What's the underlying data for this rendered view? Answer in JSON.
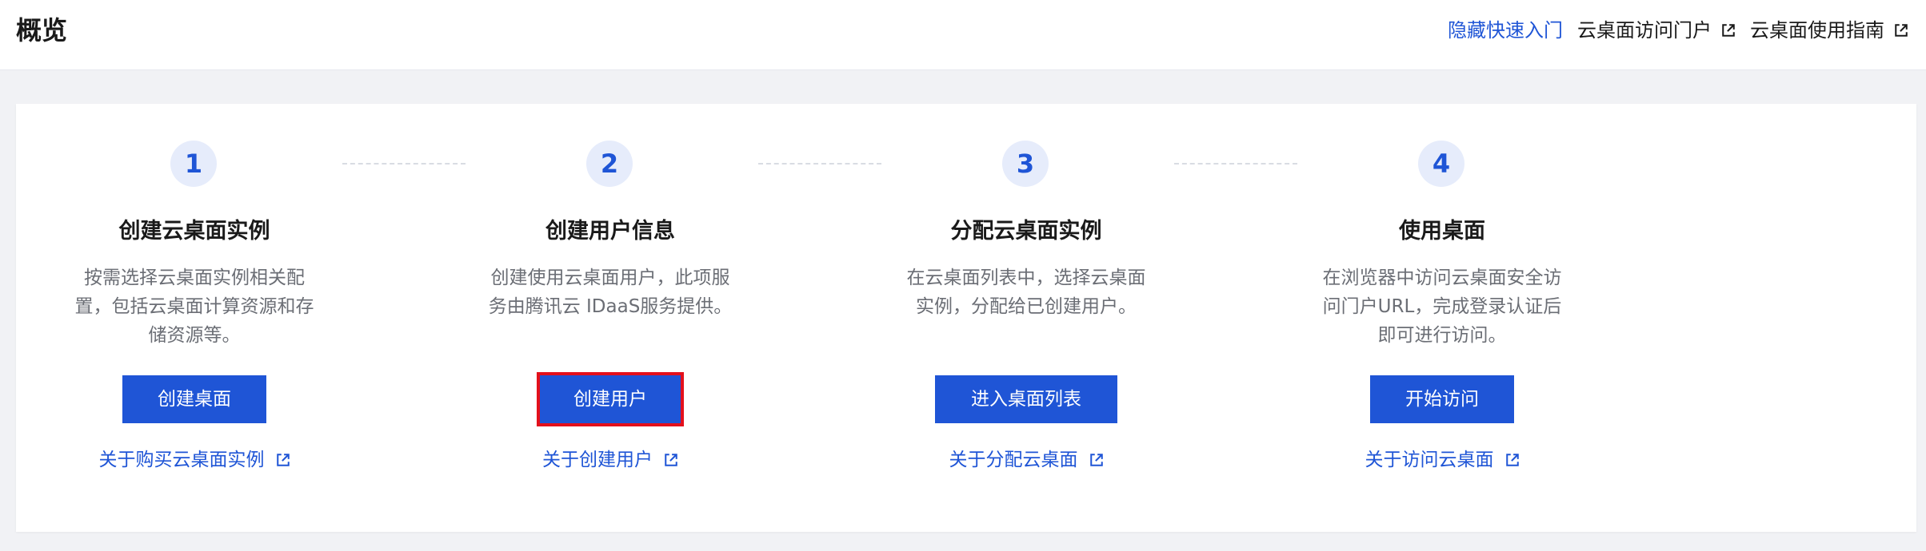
{
  "header": {
    "title": "概览",
    "links": [
      {
        "label": "隐藏快速入门",
        "external": false
      },
      {
        "label": "云桌面访问门户",
        "external": true
      },
      {
        "label": "云桌面使用指南",
        "external": true
      }
    ]
  },
  "steps": [
    {
      "number": "1",
      "title": "创建云桌面实例",
      "desc": "按需选择云桌面实例相关配置，包括云桌面计算资源和存储资源等。",
      "button": "创建桌面",
      "link": "关于购买云桌面实例"
    },
    {
      "number": "2",
      "title": "创建用户信息",
      "desc": "创建使用云桌面用户，此项服务由腾讯云 IDaaS服务提供。",
      "button": "创建用户",
      "link": "关于创建用户"
    },
    {
      "number": "3",
      "title": "分配云桌面实例",
      "desc": "在云桌面列表中，选择云桌面实例，分配给已创建用户。",
      "button": "进入桌面列表",
      "link": "关于分配云桌面"
    },
    {
      "number": "4",
      "title": "使用桌面",
      "desc": "在浏览器中访问云桌面安全访问门户URL，完成登录认证后即可进行访问。",
      "button": "开始访问",
      "link": "关于访问云桌面"
    }
  ],
  "colors": {
    "accent": "#1f55d6",
    "highlight": "#e3101c",
    "step_badge_bg": "#e6ecfb"
  }
}
